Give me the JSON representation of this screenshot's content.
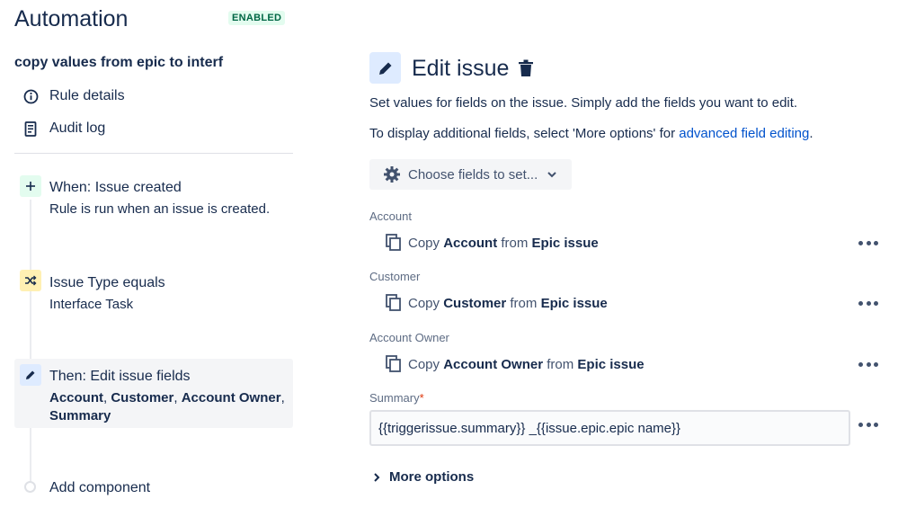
{
  "header": {
    "title": "Automation",
    "status_badge": "ENABLED"
  },
  "rule": {
    "name": "copy values from epic to interf"
  },
  "nav": [
    {
      "label": "Rule details",
      "icon": "info-icon"
    },
    {
      "label": "Audit log",
      "icon": "document-icon"
    }
  ],
  "components": {
    "trigger": {
      "title": "When: Issue created",
      "subtitle": "Rule is run when an issue is created.",
      "icon": "plus-icon"
    },
    "condition": {
      "title": "Issue Type equals",
      "subtitle": "Interface Task",
      "icon": "shuffle-icon"
    },
    "action": {
      "title": "Then: Edit issue fields",
      "fields": [
        "Account",
        "Customer",
        "Account Owner",
        "Summary"
      ],
      "sep": ", ",
      "icon": "pencil-icon"
    },
    "add_label": "Add component"
  },
  "editor": {
    "title": "Edit issue",
    "desc1": "Set values for fields on the issue. Simply add the fields you want to edit.",
    "desc2_prefix": "To display additional fields, select 'More options' for ",
    "desc2_link": "advanced field editing",
    "desc2_suffix": ".",
    "choose_fields_label": "Choose fields to set...",
    "fields": [
      {
        "label": "Account",
        "copy": "Copy",
        "field": "Account",
        "from": "from",
        "source": "Epic issue"
      },
      {
        "label": "Customer",
        "copy": "Copy",
        "field": "Customer",
        "from": "from",
        "source": "Epic issue"
      },
      {
        "label": "Account Owner",
        "copy": "Copy",
        "field": "Account Owner",
        "from": "from",
        "source": "Epic issue"
      }
    ],
    "summary": {
      "label": "Summary",
      "required_mark": "*",
      "value": "{{triggerissue.summary}} _{{issue.epic.epic name}}"
    },
    "more_options_label": "More options"
  },
  "colors": {
    "badge_bg": "#E3FCEF",
    "badge_text": "#006644",
    "trigger_icon_bg": "#E3FCEF",
    "condition_icon_bg": "#FFF0B3",
    "action_icon_bg": "#DEEBFF",
    "link": "#0052CC",
    "required": "#DE350B"
  }
}
